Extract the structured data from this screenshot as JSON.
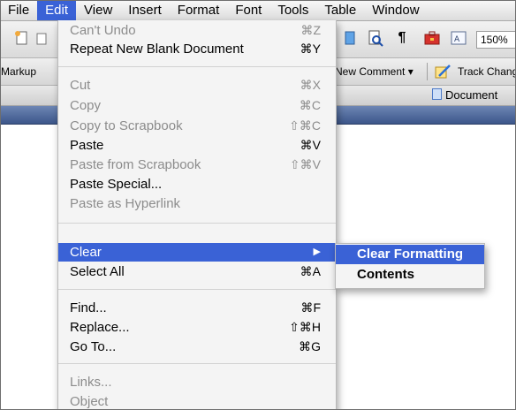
{
  "menubar": {
    "items": [
      "File",
      "Edit",
      "View",
      "Insert",
      "Format",
      "Font",
      "Tools",
      "Table",
      "Window"
    ],
    "active": "Edit"
  },
  "toolbar": {
    "zoom": "150%"
  },
  "reviewbar": {
    "markup_label": "Markup",
    "new_comment_label": "New Comment",
    "track_changes_label": "Track Changes"
  },
  "tabrow": {
    "document_label": "Document"
  },
  "edit_menu": {
    "cant_undo": {
      "label": "Can't Undo",
      "shortcut": "⌘Z"
    },
    "repeat": {
      "label": "Repeat New Blank Document",
      "shortcut": "⌘Y"
    },
    "cut": {
      "label": "Cut",
      "shortcut": "⌘X"
    },
    "copy": {
      "label": "Copy",
      "shortcut": "⌘C"
    },
    "copy_scrapbook": {
      "label": "Copy to Scrapbook",
      "shortcut": "⇧⌘C"
    },
    "paste": {
      "label": "Paste",
      "shortcut": "⌘V"
    },
    "paste_scrapbook": {
      "label": "Paste from Scrapbook",
      "shortcut": "⇧⌘V"
    },
    "paste_special": {
      "label": "Paste Special..."
    },
    "paste_hyperlink": {
      "label": "Paste as Hyperlink"
    },
    "clear": {
      "label": "Clear",
      "arrow": "▶"
    },
    "select_all": {
      "label": "Select All",
      "shortcut": "⌘A"
    },
    "find": {
      "label": "Find...",
      "shortcut": "⌘F"
    },
    "replace": {
      "label": "Replace...",
      "shortcut": "⇧⌘H"
    },
    "goto": {
      "label": "Go To...",
      "shortcut": "⌘G"
    },
    "links": {
      "label": "Links..."
    },
    "object": {
      "label": "Object"
    }
  },
  "clear_submenu": {
    "clear_formatting": "Clear Formatting",
    "contents": "Contents"
  },
  "colors": {
    "highlight": "#3a62d6",
    "ruler": "#3c568a",
    "disabled_text": "#8c8c8c"
  }
}
